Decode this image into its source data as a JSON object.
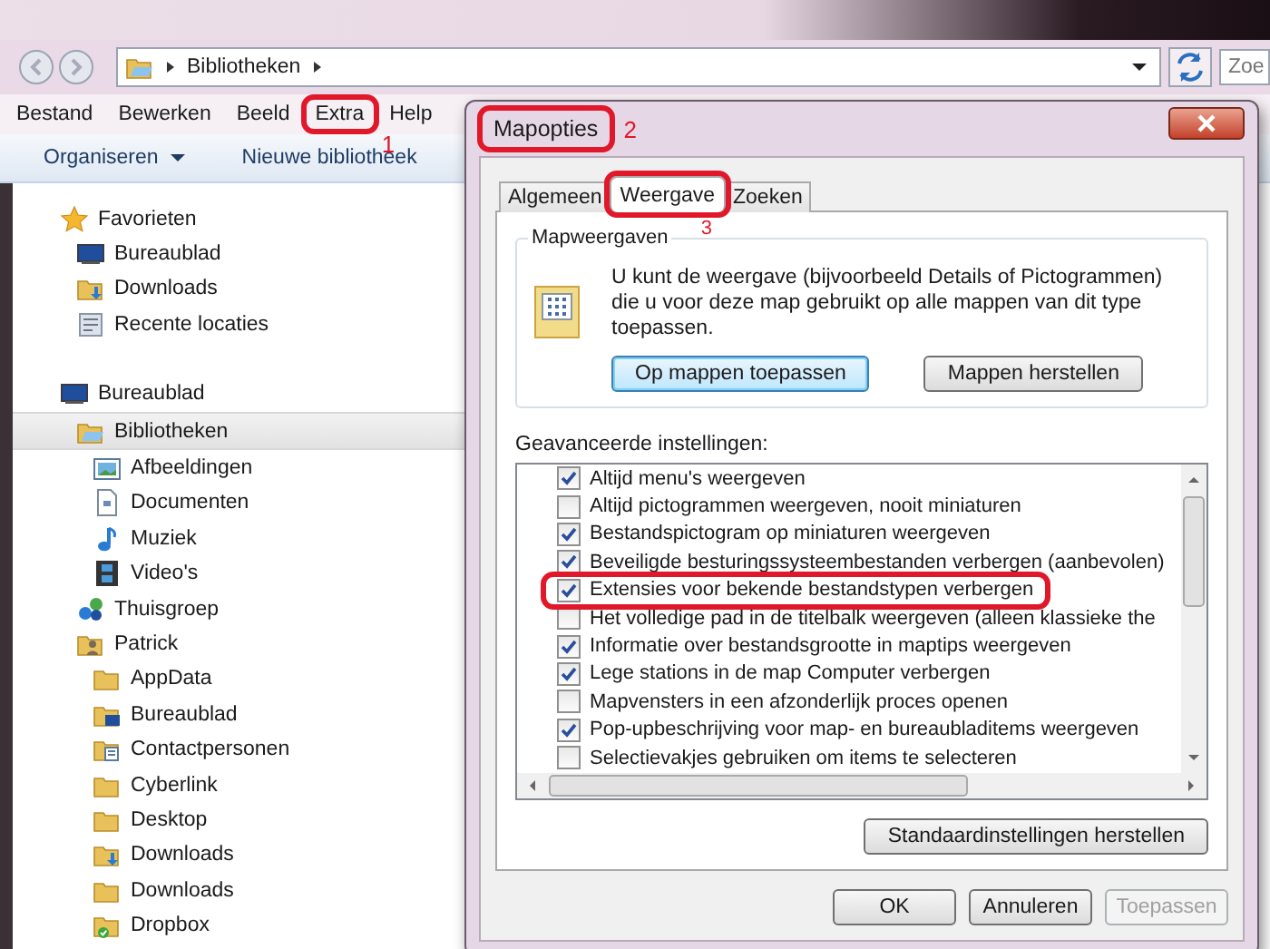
{
  "window": {
    "address_path": "Bibliotheken",
    "search_placeholder": "Zoe"
  },
  "menu_bar": [
    {
      "label": "Bestand",
      "highlighted": false
    },
    {
      "label": "Bewerken",
      "highlighted": false
    },
    {
      "label": "Beeld",
      "highlighted": false
    },
    {
      "label": "Extra",
      "highlighted": true,
      "callout": "1"
    },
    {
      "label": "Help",
      "highlighted": false
    }
  ],
  "toolbar": [
    {
      "label": "Organiseren",
      "dropdown": true
    },
    {
      "label": "Nieuwe bibliotheek",
      "dropdown": false
    }
  ],
  "navigation": [
    {
      "label": "Favorieten",
      "kind": "star",
      "selected": false,
      "children": [
        {
          "label": "Bureaublad",
          "kind": "desktop",
          "selected": false
        },
        {
          "label": "Downloads",
          "kind": "download",
          "selected": false
        },
        {
          "label": "Recente locaties",
          "kind": "recent",
          "selected": false
        }
      ]
    },
    {
      "label": "Bureaublad",
      "kind": "desktop",
      "selected": false,
      "children": [
        {
          "label": "Bibliotheken",
          "kind": "library",
          "selected": true,
          "children": [
            {
              "label": "Afbeeldingen",
              "kind": "pictures",
              "selected": false
            },
            {
              "label": "Documenten",
              "kind": "documents",
              "selected": false
            },
            {
              "label": "Muziek",
              "kind": "music",
              "selected": false
            },
            {
              "label": "Video's",
              "kind": "video",
              "selected": false
            }
          ]
        },
        {
          "label": "Thuisgroep",
          "kind": "homegroup",
          "selected": false
        },
        {
          "label": "Patrick",
          "kind": "user",
          "selected": false,
          "children": [
            {
              "label": "AppData",
              "kind": "folder",
              "selected": false
            },
            {
              "label": "Bureaublad",
              "kind": "desktop-folder",
              "selected": false
            },
            {
              "label": "Contactpersonen",
              "kind": "contacts",
              "selected": false
            },
            {
              "label": "Cyberlink",
              "kind": "folder",
              "selected": false
            },
            {
              "label": "Desktop",
              "kind": "folder",
              "selected": false
            },
            {
              "label": "Downloads",
              "kind": "download",
              "selected": false
            },
            {
              "label": "Downloads",
              "kind": "folder",
              "selected": false
            },
            {
              "label": "Dropbox",
              "kind": "dropbox",
              "selected": false
            }
          ]
        }
      ]
    }
  ],
  "dialog": {
    "title": "Mapopties",
    "title_highlighted": true,
    "title_callout": "2",
    "tabs": [
      {
        "label": "Algemeen",
        "selected": false,
        "highlighted": false
      },
      {
        "label": "Weergave",
        "selected": true,
        "highlighted": true,
        "callout": "3"
      },
      {
        "label": "Zoeken",
        "selected": false,
        "highlighted": false
      }
    ],
    "folder_views": {
      "group_title": "Mapweergaven",
      "description": "U kunt de weergave (bijvoorbeeld Details of Pictogrammen) die u voor deze map gebruikt op alle mappen van dit type toepassen.",
      "buttons": [
        {
          "label": "Op mappen toepassen",
          "focused": true
        },
        {
          "label": "Mappen herstellen",
          "focused": false
        }
      ]
    },
    "advanced_label": "Geavanceerde instellingen:",
    "advanced_settings": [
      {
        "label": "Altijd menu's weergeven",
        "checked": true,
        "highlighted": false
      },
      {
        "label": "Altijd pictogrammen weergeven, nooit miniaturen",
        "checked": false,
        "highlighted": false
      },
      {
        "label": "Bestandspictogram op miniaturen weergeven",
        "checked": true,
        "highlighted": false
      },
      {
        "label": "Beveiligde besturingssysteembestanden verbergen (aanbevolen)",
        "checked": true,
        "highlighted": false
      },
      {
        "label": "Extensies voor bekende bestandstypen verbergen",
        "checked": true,
        "highlighted": true
      },
      {
        "label": "Het volledige pad in de titelbalk weergeven (alleen klassieke the",
        "checked": false,
        "highlighted": false
      },
      {
        "label": "Informatie over bestandsgrootte in maptips weergeven",
        "checked": true,
        "highlighted": false
      },
      {
        "label": "Lege stations in de map Computer verbergen",
        "checked": true,
        "highlighted": false
      },
      {
        "label": "Mapvensters in een afzonderlijk proces openen",
        "checked": false,
        "highlighted": false
      },
      {
        "label": "Pop-upbeschrijving voor map- en bureaubladitems weergeven",
        "checked": true,
        "highlighted": false
      },
      {
        "label": "Selectievakjes gebruiken om items te selecteren",
        "checked": false,
        "highlighted": false
      }
    ],
    "restore_button": "Standaardinstellingen herstellen",
    "buttons": [
      {
        "label": "OK",
        "disabled": false
      },
      {
        "label": "Annuleren",
        "disabled": false
      },
      {
        "label": "Toepassen",
        "disabled": true
      }
    ]
  }
}
